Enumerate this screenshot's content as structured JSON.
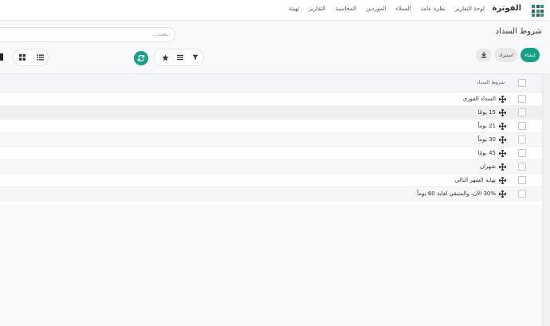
{
  "navbar": {
    "brand": "الفوترة",
    "menu": [
      "لوحة التقارير",
      "نظرة عامة",
      "العملاء",
      "الموردين",
      "المحاسبة",
      "التقارير",
      "تهيئة"
    ]
  },
  "page": {
    "title": "شروط السداد",
    "search_placeholder": "بحث...",
    "create_label": "إنشاء",
    "import_label": "استيراد"
  },
  "table": {
    "header": "شروط السداد",
    "rows": [
      "السداد الفوري",
      "15 يومًا",
      "21 يوماً",
      "30 يوماً",
      "45 يومًا",
      "شهران",
      "نهاية الشهر التالي",
      "30% الآن، والمتبقي لغاية 60 يوماً"
    ]
  },
  "colors": {
    "accent": "#16a085",
    "navbar_bg": "#ffffff",
    "page_bg": "#f9f9fb"
  },
  "icons": [
    "apps-grid-icon",
    "download-icon",
    "filter-icon",
    "list-icon",
    "star-icon",
    "refresh-icon",
    "kanban-icon",
    "drag-handle-icon"
  ]
}
